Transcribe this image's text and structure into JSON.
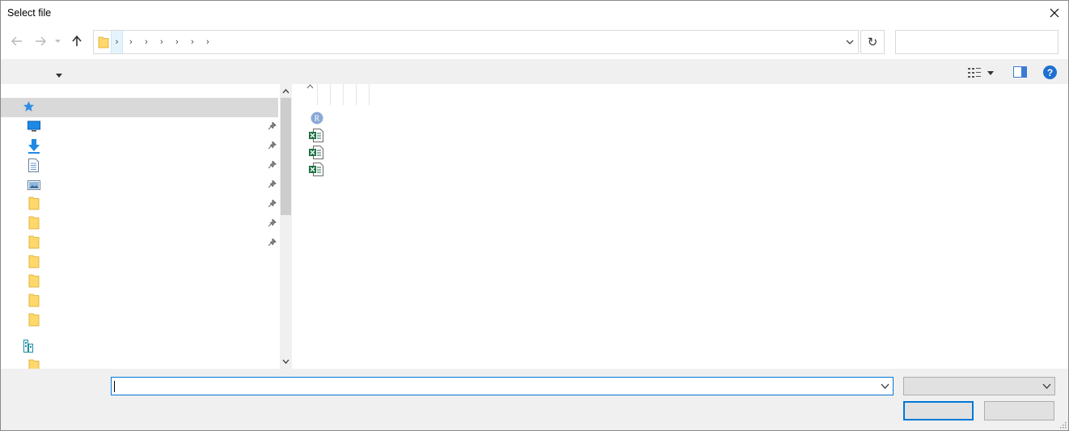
{
  "window": {
    "title": "Select file"
  },
  "nav": {
    "back_icon": "arrow-left-icon",
    "forward_icon": "arrow-right-icon",
    "recent_icon": "chevron-down-icon",
    "up_icon": "arrow-up-icon",
    "refresh_icon": "refresh-icon",
    "breadcrumb_separators": [
      "›",
      "›",
      "›",
      "›",
      "›",
      "›",
      "›"
    ],
    "search_placeholder": ""
  },
  "quick_access": {
    "items": [
      {
        "icon": "quick-access-star-icon",
        "selected": true
      },
      {
        "icon": "desktop-icon",
        "pinned": true
      },
      {
        "icon": "downloads-icon",
        "pinned": true
      },
      {
        "icon": "documents-icon",
        "pinned": true
      },
      {
        "icon": "pictures-icon",
        "pinned": true
      },
      {
        "icon": "folder-icon",
        "pinned": true
      },
      {
        "icon": "folder-icon",
        "pinned": true
      },
      {
        "icon": "folder-icon",
        "pinned": true
      },
      {
        "icon": "folder-icon"
      },
      {
        "icon": "folder-icon"
      },
      {
        "icon": "folder-icon"
      },
      {
        "icon": "folder-icon"
      },
      {
        "icon": "network-icon"
      },
      {
        "icon": "folder-icon"
      }
    ]
  },
  "files": [
    {
      "icon": "r-file-icon",
      "icon_letter": "R"
    },
    {
      "icon": "excel-file-icon"
    },
    {
      "icon": "excel-file-icon"
    },
    {
      "icon": "excel-file-icon"
    }
  ],
  "bottom": {
    "filename_value": "",
    "filetype_value": "",
    "open_label": "",
    "cancel_label": ""
  },
  "colors": {
    "accent": "#0078d7",
    "folder": "#ffd86b",
    "excel": "#1d7044",
    "help": "#1f6fd1",
    "selection": "#d9d9d9"
  }
}
